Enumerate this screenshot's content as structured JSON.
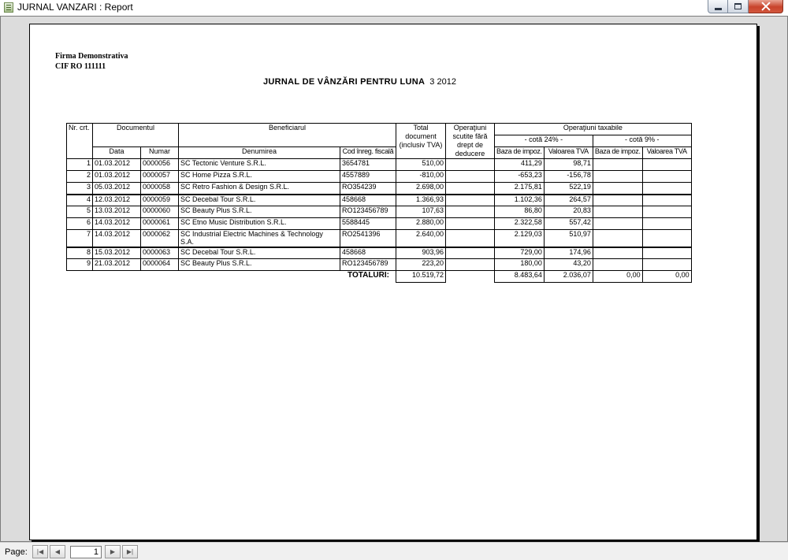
{
  "window": {
    "title": "JURNAL VANZARI : Report"
  },
  "report": {
    "company_name": "Firma Demonstrativa",
    "company_cif": "CIF  RO 111111",
    "title": "JURNAL DE VÂNZĂRI PENTRU LUNA",
    "period": "3  2012"
  },
  "table": {
    "headers": {
      "nr": "Nr. crt.",
      "document": "Documentul",
      "beneficiar": "Beneficiarul",
      "total": "Total document (inclusiv TVA)",
      "scutite": "Operaţiuni scutite fără drept de deducere",
      "taxabile": "Operaţiuni taxabile",
      "cota24": "- cotă 24%  -",
      "cota9": "- cotă 9%  -",
      "data": "Data",
      "numar": "Numar",
      "denumirea": "Denumirea",
      "cod": "Cod înreg. fiscală",
      "baza24": "Baza de impoz.",
      "tva24": "Valoarea TVA",
      "baza9": "Baza de impoz.",
      "tva9": "Valoarea TVA"
    },
    "rows": [
      {
        "nr": "1",
        "data": "01.03.2012",
        "numar": "0000056",
        "denumire": "SC Tectonic Venture S.R.L.",
        "cod": "3654781",
        "total": "510,00",
        "scutite": "",
        "baza24": "411,29",
        "tva24": "98,71",
        "baza9": "",
        "tva9": ""
      },
      {
        "nr": "2",
        "data": "01.03.2012",
        "numar": "0000057",
        "denumire": "SC Home Pizza S.R.L.",
        "cod": "4557889",
        "total": "-810,00",
        "scutite": "",
        "baza24": "-653,23",
        "tva24": "-156,78",
        "baza9": "",
        "tva9": ""
      },
      {
        "nr": "3",
        "data": "05.03.2012",
        "numar": "0000058",
        "denumire": "SC Retro Fashion & Design S.R.L.",
        "cod": "RO354239",
        "total": "2.698,00",
        "scutite": "",
        "baza24": "2.175,81",
        "tva24": "522,19",
        "baza9": "",
        "tva9": ""
      },
      {
        "nr": "4",
        "data": "12.03.2012",
        "numar": "0000059",
        "denumire": "SC Decebal Tour S.R.L.",
        "cod": "458668",
        "total": "1.366,93",
        "scutite": "",
        "baza24": "1.102,36",
        "tva24": "264,57",
        "baza9": "",
        "tva9": ""
      },
      {
        "nr": "5",
        "data": "13.03.2012",
        "numar": "0000060",
        "denumire": "SC Beauty Plus S.R.L.",
        "cod": "RO123456789",
        "total": "107,63",
        "scutite": "",
        "baza24": "86,80",
        "tva24": "20,83",
        "baza9": "",
        "tva9": ""
      },
      {
        "nr": "6",
        "data": "14.03.2012",
        "numar": "0000061",
        "denumire": "SC Etno Music Distribution S.R.L.",
        "cod": "5588445",
        "total": "2.880,00",
        "scutite": "",
        "baza24": "2.322,58",
        "tva24": "557,42",
        "baza9": "",
        "tva9": ""
      },
      {
        "nr": "7",
        "data": "14.03.2012",
        "numar": "0000062",
        "denumire": "SC Industrial Electric Machines & Technology S.A.",
        "cod": "RO2541396",
        "total": "2.640,00",
        "scutite": "",
        "baza24": "2.129,03",
        "tva24": "510,97",
        "baza9": "",
        "tva9": ""
      },
      {
        "nr": "8",
        "data": "15.03.2012",
        "numar": "0000063",
        "denumire": "SC Decebal Tour S.R.L.",
        "cod": "458668",
        "total": "903,96",
        "scutite": "",
        "baza24": "729,00",
        "tva24": "174,96",
        "baza9": "",
        "tva9": ""
      },
      {
        "nr": "9",
        "data": "21.03.2012",
        "numar": "0000064",
        "denumire": "SC Beauty Plus S.R.L.",
        "cod": "RO123456789",
        "total": "223,20",
        "scutite": "",
        "baza24": "180,00",
        "tva24": "43,20",
        "baza9": "",
        "tva9": ""
      }
    ],
    "totals": {
      "label": "TOTALURI:",
      "total": "10.519,72",
      "scutite": "",
      "baza24": "8.483,64",
      "tva24": "2.036,07",
      "baza9": "0,00",
      "tva9": "0,00"
    }
  },
  "pager": {
    "label": "Page:",
    "current_page": "1",
    "first_icon": "first-page-icon",
    "prev_icon": "previous-page-icon",
    "next_icon": "next-page-icon",
    "last_icon": "last-page-icon"
  }
}
